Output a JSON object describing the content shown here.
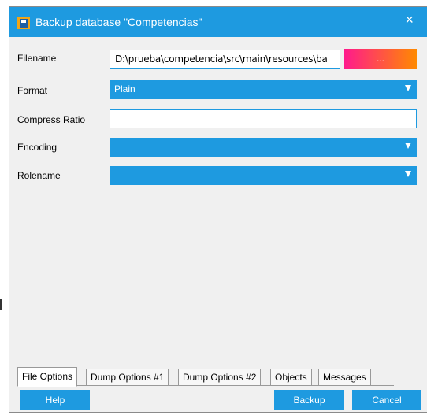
{
  "window": {
    "title": "Backup database \"Competencias\"",
    "close_label": "×"
  },
  "form": {
    "filename_label": "Filename",
    "filename_value": "D:\\prueba\\competencia\\src\\main\\resources\\ba",
    "browse_label": "...",
    "format_label": "Format",
    "format_value": "Plain",
    "compress_label": "Compress Ratio",
    "compress_value": "",
    "encoding_label": "Encoding",
    "encoding_value": "",
    "rolename_label": "Rolename",
    "rolename_value": ""
  },
  "tabs": [
    {
      "label": "File Options",
      "active": true
    },
    {
      "label": "Dump Options #1"
    },
    {
      "label": "Dump Options #2"
    },
    {
      "label": "Objects"
    },
    {
      "label": "Messages"
    }
  ],
  "buttons": {
    "help": "Help",
    "backup": "Backup",
    "cancel": "Cancel"
  },
  "colors": {
    "accent": "#1e9ae0",
    "browse_start": "#ff1a8c",
    "browse_end": "#ff8a00",
    "dialog_bg": "#f0f0f0"
  }
}
